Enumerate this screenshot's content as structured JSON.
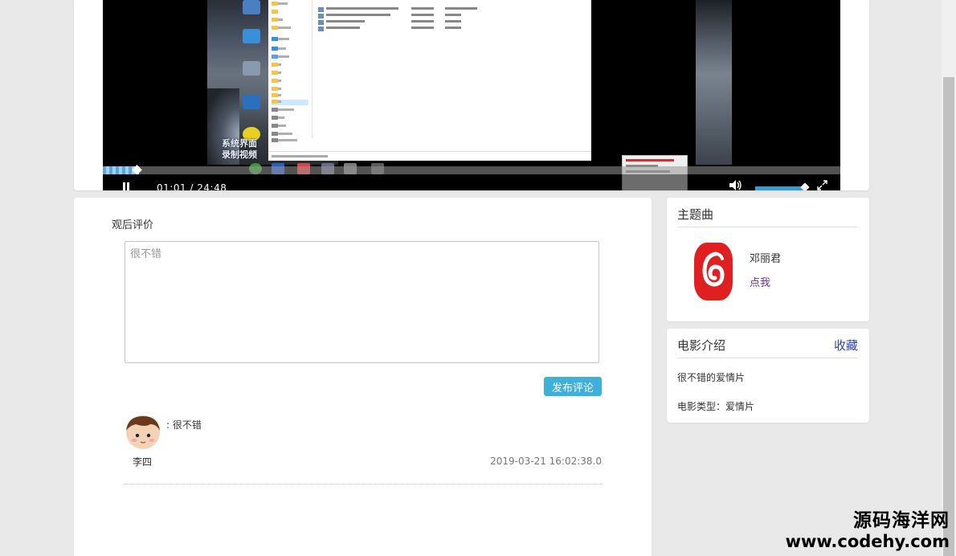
{
  "player": {
    "time_display": "01:01  /  24:48",
    "video_overlay_text": "系统界面\n录制视频"
  },
  "comments": {
    "section_title": "观后评价",
    "input_placeholder": "很不错",
    "submit_label": "发布评论",
    "items": [
      {
        "user": "李四",
        "text": ": 很不错",
        "time": "2019-03-21 16:02:38.0"
      }
    ]
  },
  "theme_song": {
    "title": "主题曲",
    "singer": "邓丽君",
    "link_label": "点我"
  },
  "movie_intro": {
    "title": "电影介绍",
    "favorite_label": "收藏",
    "description": "很不错的爱情片",
    "type_text": "电影类型：爱情片"
  },
  "watermark": {
    "site_name": "源码海洋网",
    "url": "www.codehy.com"
  },
  "colors": {
    "accent": "#3fb0d9",
    "link_blue": "#2a3fbd",
    "link_purple": "#6a2fa7",
    "netease_red": "#e02020"
  }
}
